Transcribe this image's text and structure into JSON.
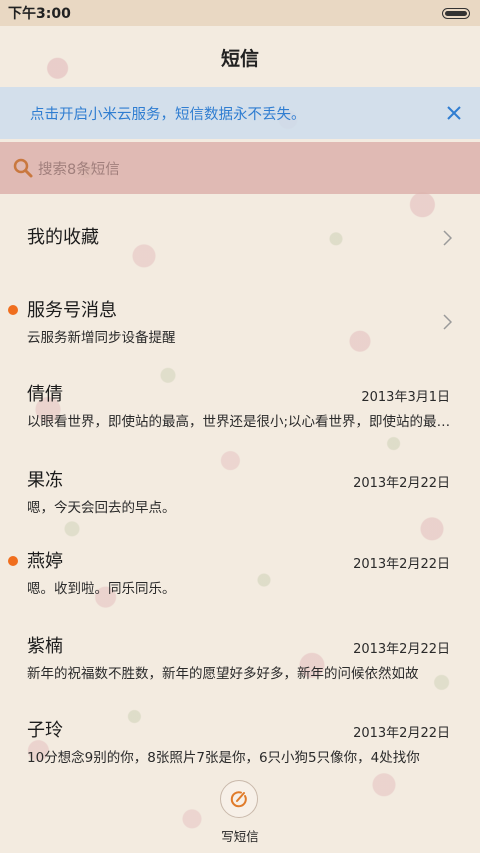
{
  "status": {
    "time": "下午3:00"
  },
  "header": {
    "title": "短信"
  },
  "banner": {
    "text": "点击开启小米云服务，短信数据永不丢失。"
  },
  "search": {
    "placeholder": "搜索8条短信"
  },
  "favorites": {
    "label": "我的收藏"
  },
  "service": {
    "name": "服务号消息",
    "preview": "云服务新增同步设备提醒"
  },
  "conversations": [
    {
      "name": "倩倩",
      "date": "2013年3月1日",
      "preview": "以眼看世界，即使站的最高，世界还是很小;以心看世界，即使站的最低，世界也是很大"
    },
    {
      "name": "果冻",
      "date": "2013年2月22日",
      "preview": "嗯，今天会回去的早点。"
    },
    {
      "name": "燕婷",
      "date": "2013年2月22日",
      "preview": "嗯。收到啦。同乐同乐。"
    },
    {
      "name": "紫楠",
      "date": "2013年2月22日",
      "preview": "新年的祝福数不胜数，新年的愿望好多好多，新年的问候依然如故"
    },
    {
      "name": "子玲",
      "date": "2013年2月22日",
      "preview": "10分想念9别的你，8张照片7张是你，6只小狗5只像你，4处找你"
    }
  ],
  "compose": {
    "label": "写短信"
  },
  "colors": {
    "accent": "#2f7dd1",
    "unread_dot": "#f06e1e"
  }
}
